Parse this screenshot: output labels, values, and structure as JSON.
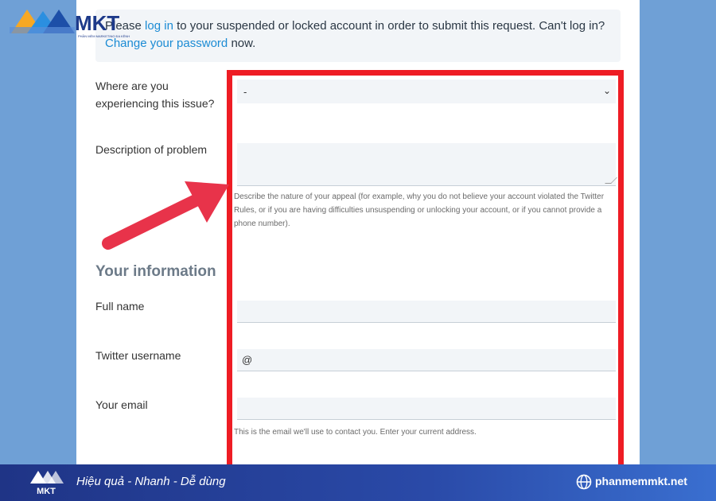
{
  "notice": {
    "prefix": "Please",
    "login_link": "log in",
    "middle": "to your suspended or locked account in order to submit this request. Can't log in?",
    "change_link": "Change your password",
    "suffix": "now."
  },
  "form": {
    "issue_location_label": "Where are you experiencing this issue?",
    "issue_location_value": "-",
    "description_label": "Description of problem",
    "description_value": "",
    "description_help": "Describe the nature of your appeal (for example, why you do not believe your account violated the Twitter Rules, or if you are having difficulties unsuspending or unlocking your account, or if you cannot provide a phone number).",
    "section_title": "Your information",
    "full_name_label": "Full name",
    "full_name_value": "",
    "username_label": "Twitter username",
    "username_prefix": "@",
    "email_label": "Your email",
    "email_value": "",
    "email_help": "This is the email we'll use to contact you. Enter your current address."
  },
  "branding": {
    "logo_text": "MKT",
    "logo_tagline": "PHẦN MỀM MARKETING ĐA KÊNH",
    "slogan": "Hiệu quả - Nhanh - Dễ dùng",
    "website": "phanmemmkt.net",
    "highlight_color": "#ee1c24",
    "arrow_color": "#e8334a"
  },
  "icons": [
    "chevron-down-icon",
    "resize-handle-icon",
    "arrow-icon",
    "globe-icon",
    "mkt-logo-icon"
  ]
}
